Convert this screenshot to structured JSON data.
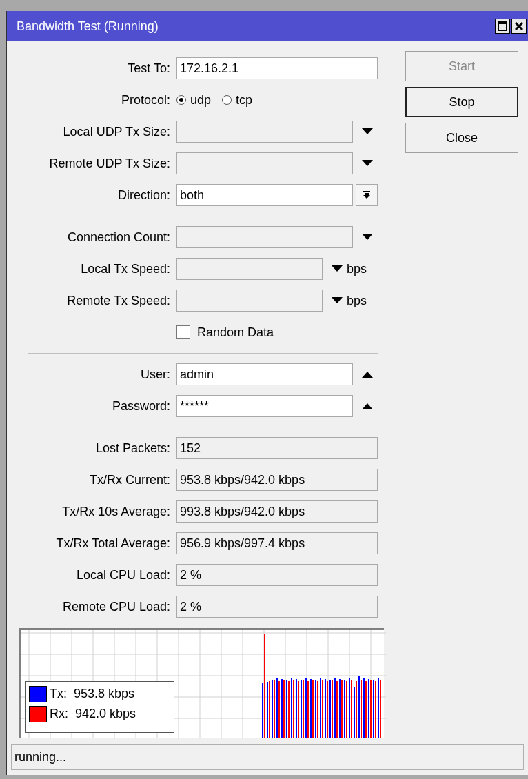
{
  "window": {
    "title": "Bandwidth Test (Running)"
  },
  "sections": [
    [
      {
        "kind": "text",
        "label": "Test To:",
        "value": "172.16.2.1"
      },
      {
        "kind": "radio",
        "label": "Protocol:",
        "options": [
          {
            "label": "udp",
            "selected": true
          },
          {
            "label": "tcp",
            "selected": false
          }
        ]
      },
      {
        "kind": "dropdown",
        "label": "Local UDP Tx Size:",
        "expanded": false
      },
      {
        "kind": "dropdown",
        "label": "Remote UDP Tx Size:",
        "expanded": false
      },
      {
        "kind": "select",
        "label": "Direction:",
        "value": "both"
      }
    ],
    [
      {
        "kind": "dropdown",
        "label": "Connection Count:",
        "expanded": false
      },
      {
        "kind": "dropdown",
        "label": "Local Tx Speed:",
        "unit": "bps",
        "expanded": false
      },
      {
        "kind": "dropdown",
        "label": "Remote Tx Speed:",
        "unit": "bps",
        "expanded": false
      },
      {
        "kind": "checkbox",
        "label": "Random Data",
        "checked": false
      }
    ],
    [
      {
        "kind": "dropdown",
        "label": "User:",
        "value": "admin",
        "expanded": true
      },
      {
        "kind": "dropdown",
        "label": "Password:",
        "value": "******",
        "expanded": true
      }
    ],
    [
      {
        "kind": "readonly",
        "label": "Lost Packets:",
        "value": "152"
      },
      {
        "kind": "readonly",
        "label": "Tx/Rx Current:",
        "value": "953.8 kbps/942.0 kbps"
      },
      {
        "kind": "readonly",
        "label": "Tx/Rx 10s Average:",
        "value": "993.8 kbps/942.0 kbps"
      },
      {
        "kind": "readonly",
        "label": "Tx/Rx Total Average:",
        "value": "956.9 kbps/997.4 kbps"
      },
      {
        "kind": "readonly",
        "label": "Local CPU Load:",
        "value": "2 %"
      },
      {
        "kind": "readonly",
        "label": "Remote CPU Load:",
        "value": "2 %"
      }
    ]
  ],
  "buttons": [
    {
      "label": "Start",
      "disabled": true,
      "focused": false
    },
    {
      "label": "Stop",
      "disabled": false,
      "focused": true
    },
    {
      "label": "Close",
      "disabled": false,
      "focused": false
    }
  ],
  "graph": {
    "legend": [
      {
        "label": "Tx:",
        "value": "953.8 kbps",
        "color": "#0000ff"
      },
      {
        "label": "Rx:",
        "value": "942.0 kbps",
        "color": "#ff0000"
      }
    ]
  },
  "status_bar": {
    "text": "running..."
  }
}
